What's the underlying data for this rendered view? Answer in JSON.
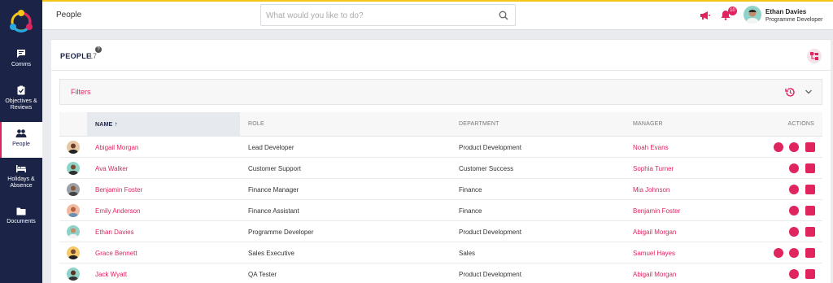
{
  "sidebar": {
    "items": [
      {
        "label": "Comms",
        "icon": "chat-icon"
      },
      {
        "label": "Objectives & Reviews",
        "icon": "clipboard-check-icon"
      },
      {
        "label": "People",
        "icon": "people-icon",
        "active": true
      },
      {
        "label": "Holidays & Absence",
        "icon": "bed-icon"
      },
      {
        "label": "Documents",
        "icon": "folder-icon"
      }
    ]
  },
  "header": {
    "page_title": "People",
    "search_placeholder": "What would you like to do?",
    "notification_count": "10",
    "user_name": "Ethan Davies",
    "user_role": "Programme Developer"
  },
  "card": {
    "title": "PEOPLE",
    "count": "17",
    "help": "?",
    "filters_label": "Filters"
  },
  "table": {
    "columns": {
      "name": "NAME",
      "role": "ROLE",
      "department": "DEPARTMENT",
      "manager": "MANAGER",
      "actions": "ACTIONS"
    },
    "rows": [
      {
        "name": "Abigail Morgan",
        "role": "Lead Developer",
        "department": "Product Development",
        "manager": "Noah Evans",
        "actions": [
          "star",
          "org",
          "book"
        ]
      },
      {
        "name": "Ava Walker",
        "role": "Customer Support",
        "department": "Customer Success",
        "manager": "Sophia Turner",
        "actions": [
          "star",
          "book"
        ]
      },
      {
        "name": "Benjamin Foster",
        "role": "Finance Manager",
        "department": "Finance",
        "manager": "Mia Johnson",
        "actions": [
          "star",
          "book"
        ]
      },
      {
        "name": "Emily Anderson",
        "role": "Finance Assistant",
        "department": "Finance",
        "manager": "Benjamin Foster",
        "actions": [
          "star",
          "book"
        ]
      },
      {
        "name": "Ethan Davies",
        "role": "Programme Developer",
        "department": "Product Development",
        "manager": "Abigail Morgan",
        "actions": [
          "star",
          "book"
        ]
      },
      {
        "name": "Grace Bennett",
        "role": "Sales Executive",
        "department": "Sales",
        "manager": "Samuel Hayes",
        "actions": [
          "star",
          "org",
          "book"
        ]
      },
      {
        "name": "Jack Wyatt",
        "role": "QA Tester",
        "department": "Product Development",
        "manager": "Abigail Morgan",
        "actions": [
          "star",
          "book"
        ]
      }
    ]
  },
  "colors": {
    "accent": "#e0245e",
    "sidebar": "#1b2447",
    "topline": "#f5c518"
  }
}
